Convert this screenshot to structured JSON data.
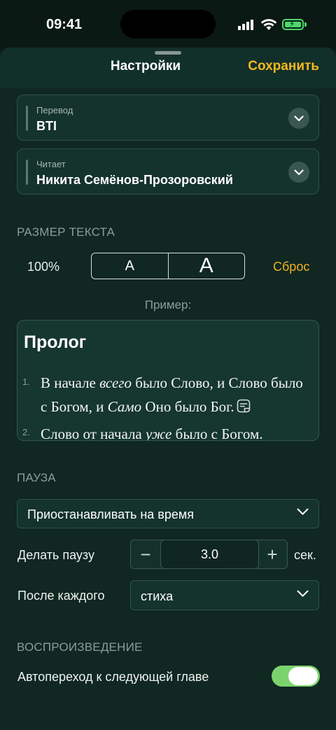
{
  "status_bar": {
    "time": "09:41"
  },
  "header": {
    "title": "Настройки",
    "save_label": "Сохранить"
  },
  "translation": {
    "label": "Перевод",
    "value": "BTI"
  },
  "reader": {
    "label": "Читает",
    "value": "Никита Семёнов-Прозоровский"
  },
  "text_size": {
    "section_title": "РАЗМЕР ТЕКСТА",
    "percent": "100%",
    "smaller_label": "A",
    "larger_label": "A",
    "reset_label": "Сброс"
  },
  "example": {
    "label": "Пример:",
    "title": "Пролог",
    "verses": [
      {
        "num": "1.",
        "line1_a": "В начале ",
        "line1_i": "всего",
        "line1_b": " было Слово, и Слово было",
        "line2_a": "с Богом, и ",
        "line2_i": "Само",
        "line2_b": " Оно было Бог."
      },
      {
        "num": "2.",
        "line1_a": "Слово от начала ",
        "line1_i": "уже",
        "line1_b": " было с Богом."
      }
    ]
  },
  "pause": {
    "section_title": "ПАУЗА",
    "mode": "Приостанавливать на время",
    "duration_label": "Делать паузу",
    "duration_value": "3.0",
    "duration_unit": "сек.",
    "minus": "−",
    "plus": "+",
    "after_label": "После каждого",
    "after_value": "стиха"
  },
  "playback": {
    "section_title": "ВОСПРОИЗВЕДЕНИЕ",
    "autonext_label": "Автопереход к следующей главе",
    "autonext_on": true
  },
  "colors": {
    "accent": "#f5b91e",
    "toggle_on": "#7bd36e",
    "background": "#102722"
  }
}
